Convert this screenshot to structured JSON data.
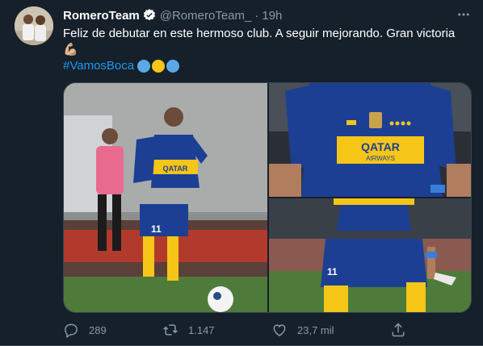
{
  "tweet": {
    "display_name": "RomeroTeam",
    "handle": "@RomeroTeam_",
    "separator": "·",
    "time": "19h",
    "text_line1": "Feliz de debutar en este hermoso club. A seguir mejorando. Gran victoria",
    "emoji_flex": "💪🏼",
    "hashtag": "#VamosBoca",
    "circle_colors": [
      "#5aa9e6",
      "#f5c518",
      "#5aa9e6"
    ]
  },
  "actions": {
    "replies": "289",
    "retweets": "1.147",
    "likes": "23,7 mil"
  },
  "photos": {
    "p1_shirt_text": "QATAR",
    "p1_number": "11",
    "p2_shirt_text": "QATAR",
    "p2_shirt_subtext": "AIRWAYS",
    "p3_number": "11"
  },
  "colors": {
    "background": "#15202b",
    "accent": "#1d9bf0",
    "muted": "#8899a6",
    "boca_blue": "#1c3f94",
    "boca_yellow": "#f5c518"
  }
}
